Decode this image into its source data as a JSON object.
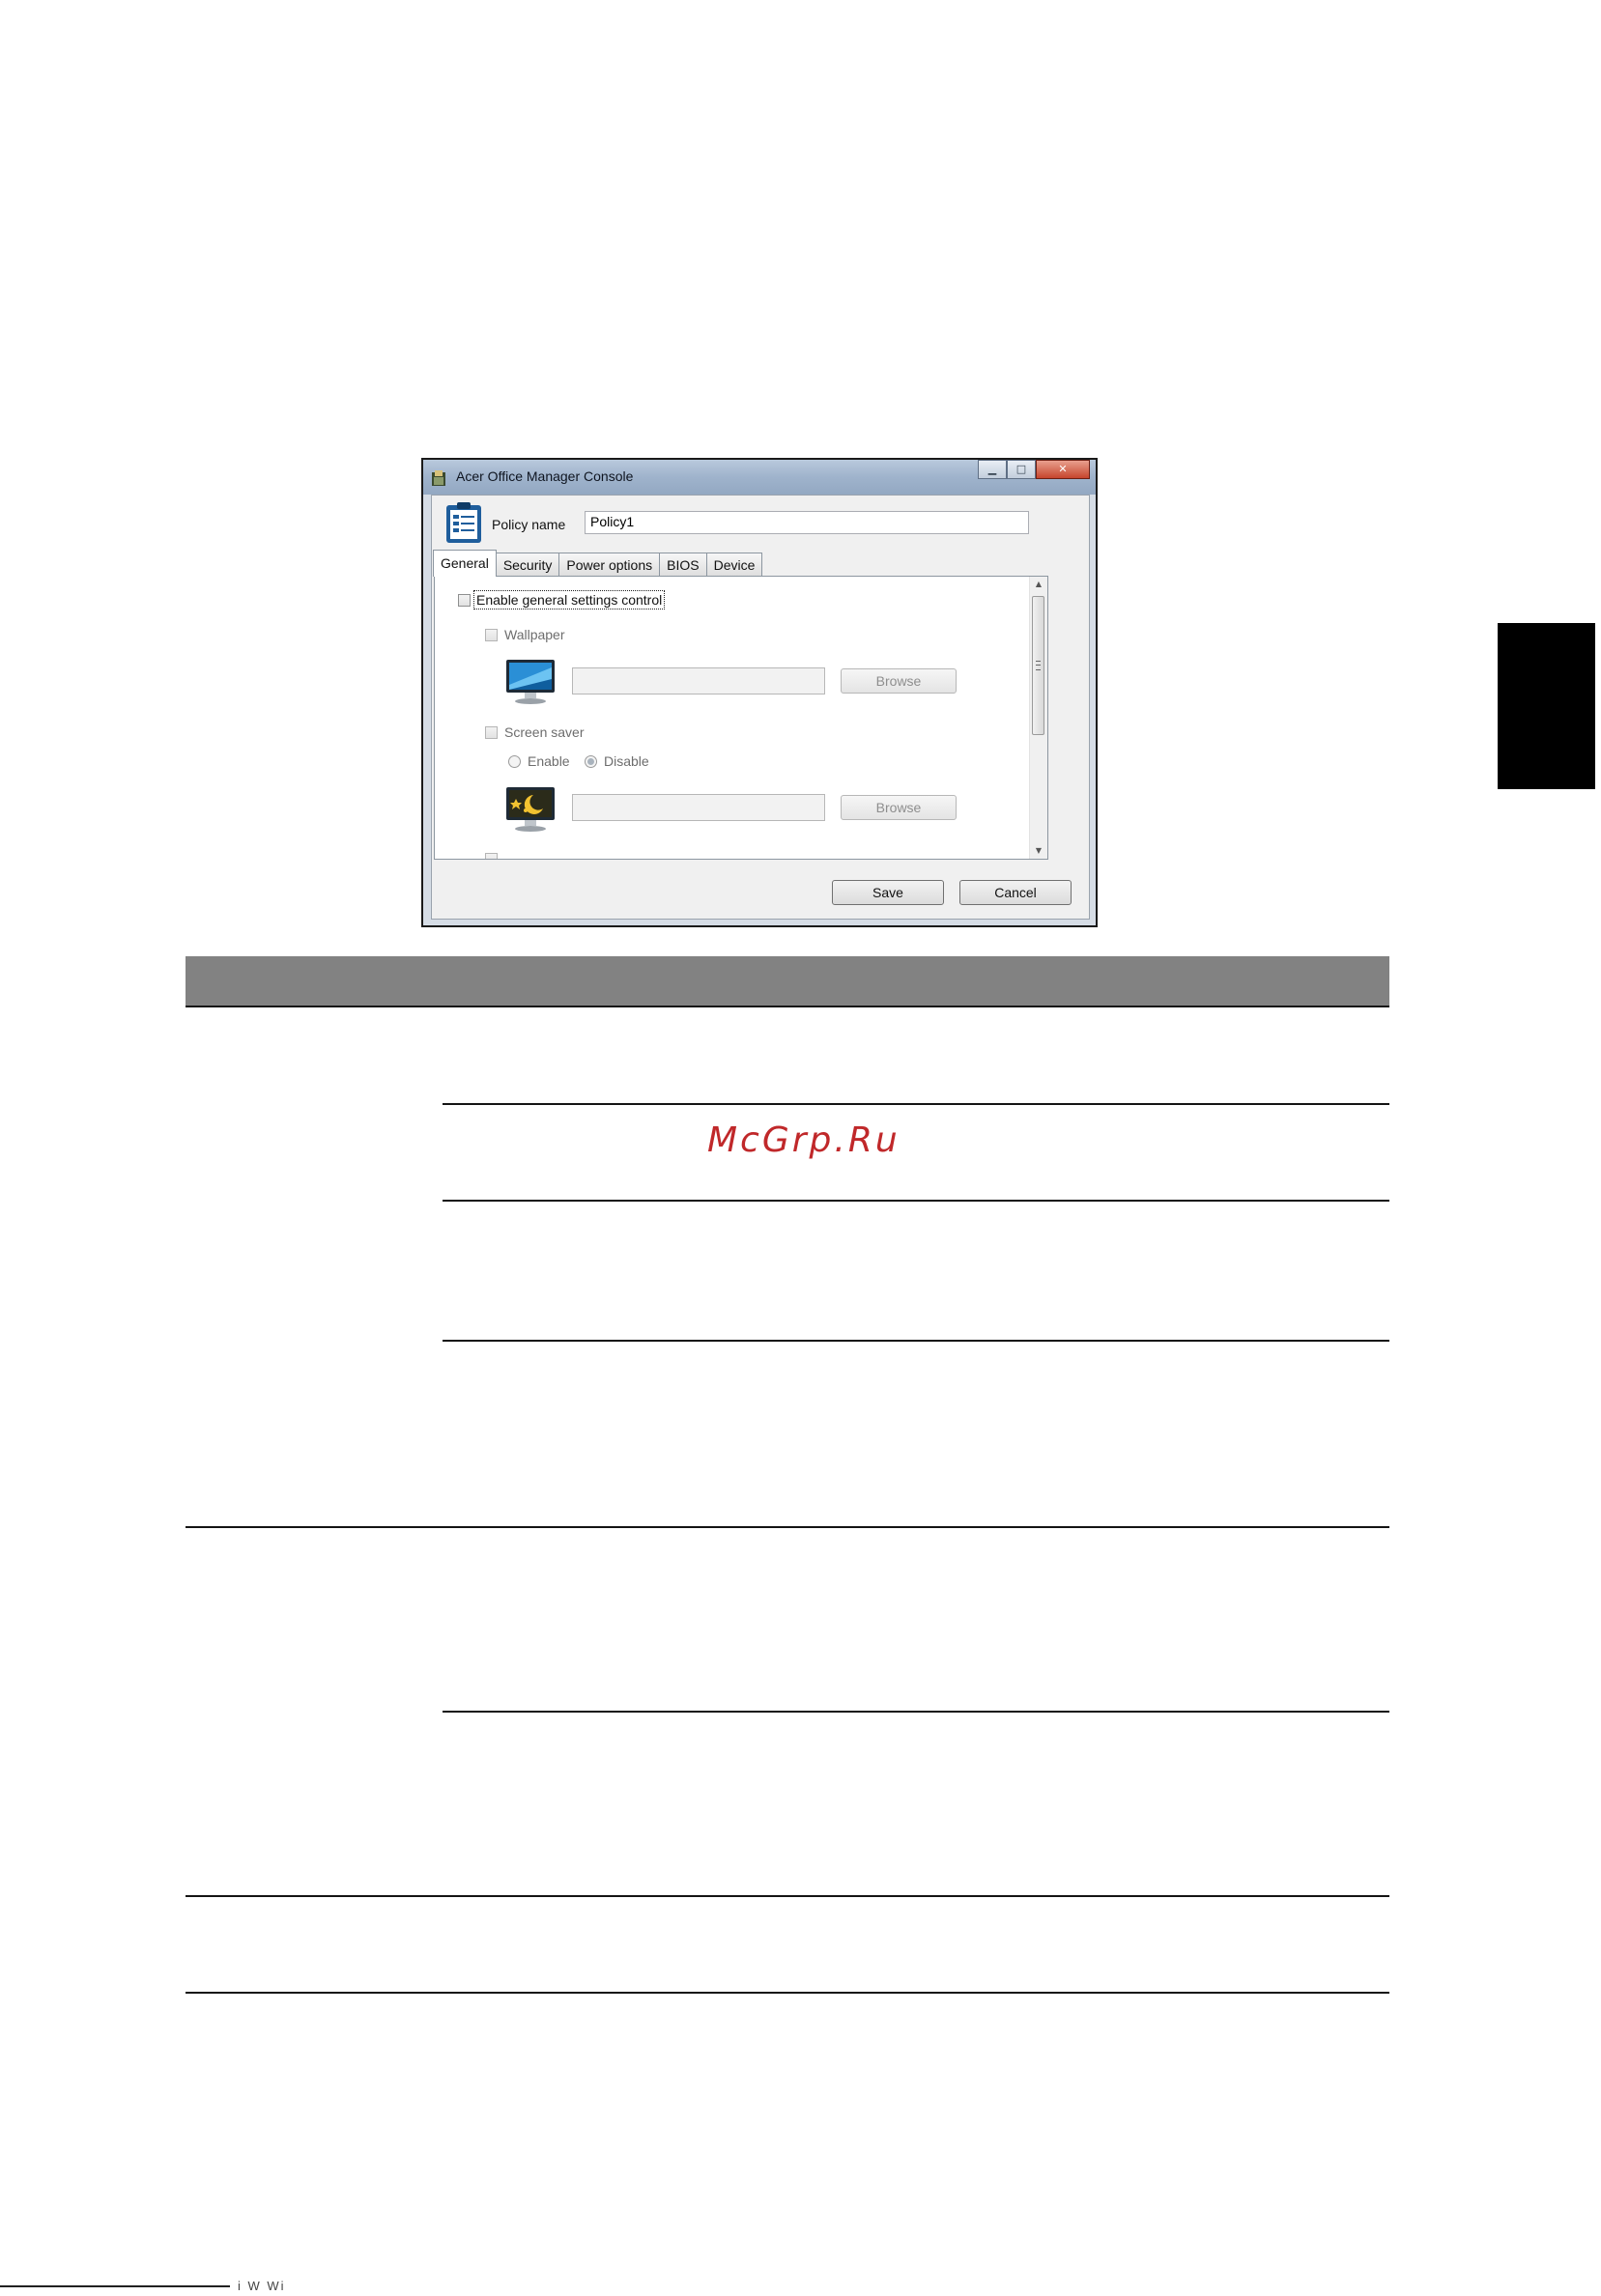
{
  "window": {
    "title": "Acer Office Manager Console",
    "minimize_glyph": "▁",
    "maximize_glyph": "□",
    "close_glyph": "✕"
  },
  "policy": {
    "label": "Policy name",
    "value": "Policy1"
  },
  "tabs": [
    {
      "label": "General",
      "active": true
    },
    {
      "label": "Security",
      "active": false
    },
    {
      "label": "Power options",
      "active": false
    },
    {
      "label": "BIOS",
      "active": false
    },
    {
      "label": "Device",
      "active": false
    }
  ],
  "general": {
    "enable_label": "Enable general settings control",
    "wallpaper": {
      "label": "Wallpaper",
      "path": "",
      "browse_label": "Browse",
      "icon": "monitor-wallpaper-icon"
    },
    "screensaver": {
      "label": "Screen saver",
      "enable_label": "Enable",
      "disable_label": "Disable",
      "selected": "Disable",
      "path": "",
      "browse_label": "Browse",
      "icon": "monitor-screensaver-icon"
    }
  },
  "buttons": {
    "save": "Save",
    "cancel": "Cancel"
  },
  "watermark": "McGrp.Ru",
  "footer_fragment": "i    W  Wi   "
}
